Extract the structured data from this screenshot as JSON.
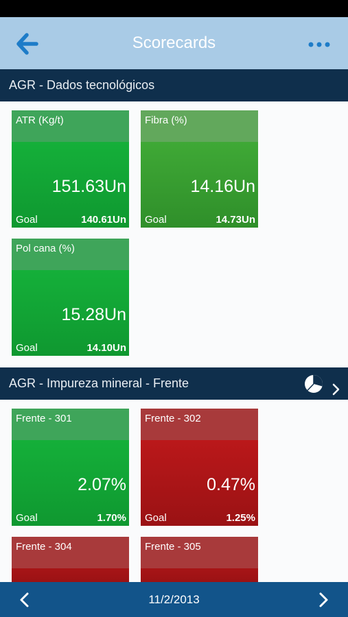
{
  "nav": {
    "title": "Scorecards",
    "back_icon": "arrow-left-icon",
    "more_icon": "more-dots-icon"
  },
  "colors": {
    "navbar": "#a9cbe6",
    "section": "#0f2f4c",
    "footer": "#12548a",
    "good": "#17b83d",
    "bad": "#c61a1c",
    "accent": "#1e7cc8"
  },
  "sections": [
    {
      "title": "AGR - Dados tecnológicos",
      "tiles": [
        {
          "name": "ATR (Kg/t)",
          "value": "151.63Un",
          "goal_label": "Goal",
          "goal": "140.61Un",
          "status": "good"
        },
        {
          "name": "Fibra (%)",
          "value": "14.16Un",
          "goal_label": "Goal",
          "goal": "14.73Un",
          "status": "good"
        },
        {
          "name": "Pol cana (%)",
          "value": "15.28Un",
          "goal_label": "Goal",
          "goal": "14.10Un",
          "status": "good"
        }
      ]
    },
    {
      "title": "AGR - Impureza mineral - Frente",
      "tiles": [
        {
          "name": "Frente - 301",
          "value": "2.07%",
          "goal_label": "Goal",
          "goal": "1.70%",
          "status": "good"
        },
        {
          "name": "Frente - 302",
          "value": "0.47%",
          "goal_label": "Goal",
          "goal": "1.25%",
          "status": "bad"
        },
        {
          "name": "Frente - 304",
          "status": "bad"
        },
        {
          "name": "Frente - 305",
          "status": "bad"
        }
      ]
    }
  ],
  "footer": {
    "date": "11/2/2013",
    "prev_icon": "chevron-left-icon",
    "next_icon": "chevron-right-icon"
  }
}
